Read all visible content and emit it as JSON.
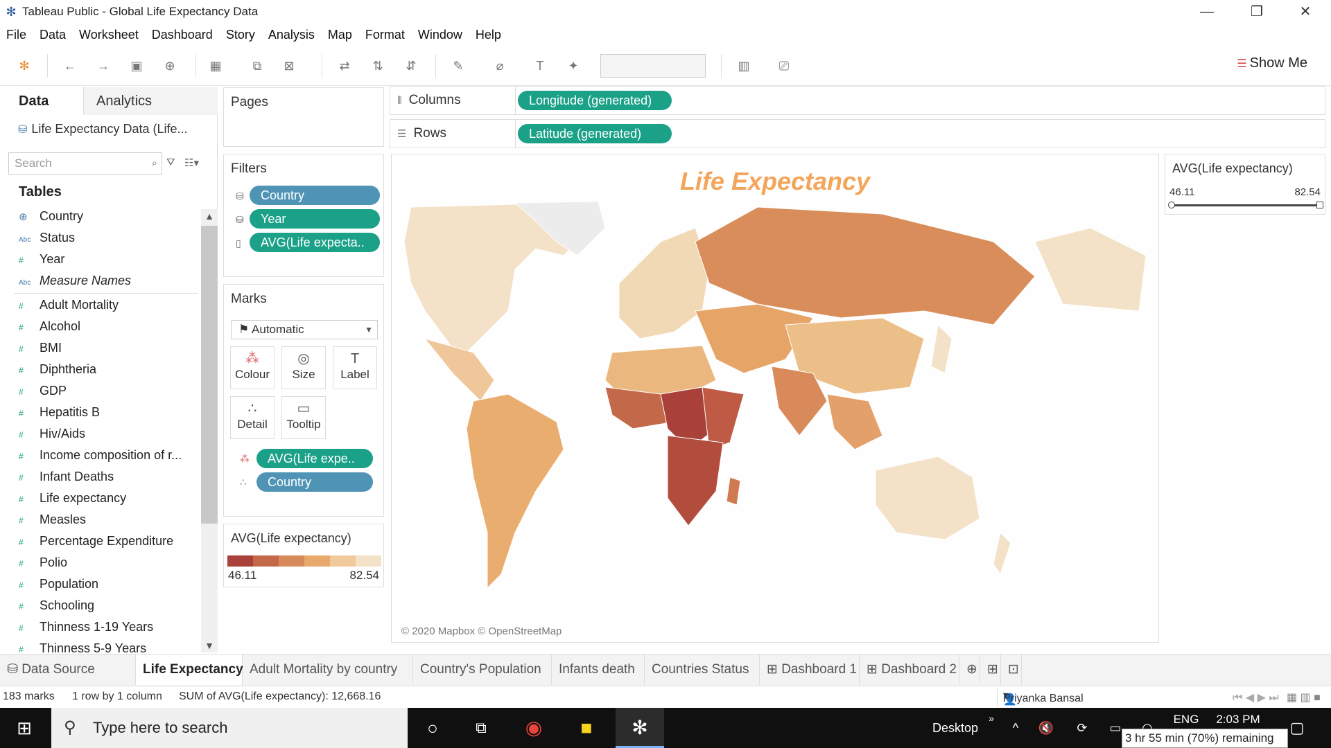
{
  "window": {
    "title": "Tableau Public - Global Life Expectancy Data"
  },
  "menu": [
    "File",
    "Data",
    "Worksheet",
    "Dashboard",
    "Story",
    "Analysis",
    "Map",
    "Format",
    "Window",
    "Help"
  ],
  "toolbar": {
    "show_me_label": "Show Me"
  },
  "data_pane": {
    "tab_data": "Data",
    "tab_analytics": "Analytics",
    "datasource": "Life Expectancy Data (Life...",
    "search_placeholder": "Search",
    "tables_heading": "Tables",
    "dimensions": [
      {
        "name": "Country",
        "type": "geo"
      },
      {
        "name": "Status",
        "type": "abc"
      },
      {
        "name": "Year",
        "type": "num"
      },
      {
        "name": "Measure Names",
        "type": "abc"
      }
    ],
    "measures": [
      "Adult Mortality",
      "Alcohol",
      "BMI",
      "Diphtheria",
      "GDP",
      "Hepatitis B",
      "Hiv/Aids",
      "Income composition of r...",
      "Infant Deaths",
      "Life expectancy",
      "Measles",
      "Percentage Expenditure",
      "Polio",
      "Population",
      "Schooling",
      "Thinness  1-19 Years",
      "Thinness 5-9 Years"
    ]
  },
  "pages": {
    "label": "Pages"
  },
  "filters": {
    "label": "Filters",
    "items": [
      {
        "label": "Country",
        "color": "blue"
      },
      {
        "label": "Year",
        "color": "green"
      },
      {
        "label": "AVG(Life expecta..",
        "color": "green"
      }
    ]
  },
  "marks": {
    "label": "Marks",
    "type": "Automatic",
    "buttons": [
      "Colour",
      "Size",
      "Label",
      "Detail",
      "Tooltip"
    ],
    "fields": [
      {
        "label": "AVG(Life expe..",
        "color": "green"
      },
      {
        "label": "Country",
        "color": "blue"
      }
    ]
  },
  "color_legend": {
    "title": "AVG(Life expectancy)",
    "min": "46.11",
    "max": "82.54",
    "colors": [
      "#a9413a",
      "#c4684a",
      "#d98a5a",
      "#e8a96c",
      "#f2c99a",
      "#f4e2c8"
    ]
  },
  "shelves": {
    "columns_label": "Columns",
    "columns_pill": "Longitude (generated)",
    "rows_label": "Rows",
    "rows_pill": "Latitude (generated)"
  },
  "viz": {
    "title": "Life Expectancy",
    "attribution": "© 2020 Mapbox © OpenStreetMap"
  },
  "range_filter": {
    "title": "AVG(Life expectancy)",
    "min": "46.11",
    "max": "82.54"
  },
  "sheet_tabs": {
    "data_source": "Data Source",
    "sheets": [
      "Life Expectancy",
      "Adult Mortality by country",
      "Country's Population",
      "Infants death",
      "Countries Status",
      "Dashboard 1",
      "Dashboard 2"
    ]
  },
  "status": {
    "marks": "183 marks",
    "rows_cols": "1 row by 1 column",
    "sum": "SUM of AVG(Life expectancy): 12,668.16",
    "user": "Priyanka Bansal"
  },
  "taskbar": {
    "search_placeholder": "Type here to search",
    "desktop": "Desktop",
    "lang": "ENG",
    "time": "2:03 PM",
    "battery_tip": "3 hr 55 min (70%) remaining"
  }
}
